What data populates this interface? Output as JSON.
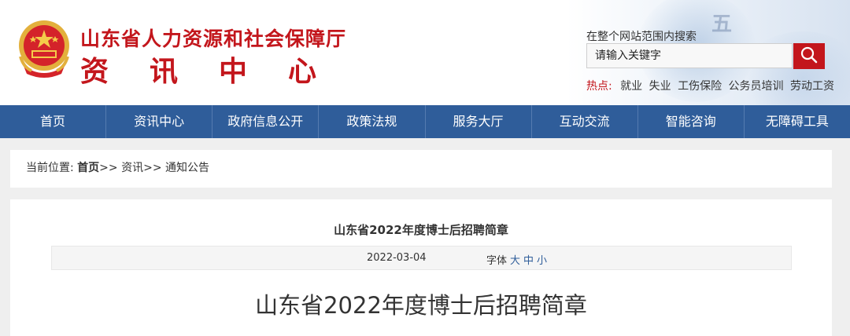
{
  "header": {
    "site_title": "山东省人力资源和社会保障厅",
    "site_sub": [
      "资",
      "讯",
      "中",
      "心"
    ],
    "deco_char": "五",
    "colors": {
      "brand_red": "#c3161c",
      "nav_blue": "#2f5d9a"
    }
  },
  "search": {
    "label": "在整个网站范围内搜索",
    "value": "请输入关键字",
    "button_icon": "search-icon"
  },
  "hot": {
    "label": "热点:",
    "items": [
      "就业",
      "失业",
      "工伤保险",
      "公务员培训",
      "劳动工资"
    ]
  },
  "nav": {
    "items": [
      "首页",
      "资讯中心",
      "政府信息公开",
      "政策法规",
      "服务大厅",
      "互动交流",
      "智能咨询",
      "无障碍工具"
    ]
  },
  "breadcrumb": {
    "prefix": "当前位置:",
    "home": "首页",
    "sep1": ">> ",
    "level1": "资讯",
    "sep2": ">> ",
    "level2": "通知公告"
  },
  "article": {
    "title": "山东省2022年度博士后招聘简章",
    "date": "2022-03-04",
    "font_label": "字体",
    "font_sizes": [
      "大",
      "中",
      "小"
    ],
    "heading": "山东省2022年度博士后招聘简章"
  }
}
